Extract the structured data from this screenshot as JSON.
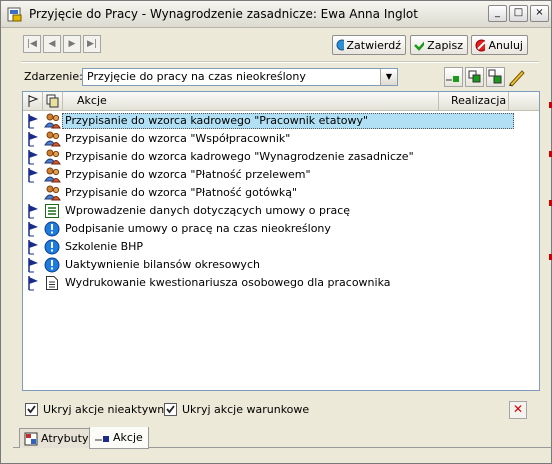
{
  "window": {
    "title": "Przyjęcie do Pracy - Wynagrodzenie zasadnicze:  Ewa Anna Inglot",
    "controls": {
      "minimize": "_",
      "maximize": "□",
      "close": "×"
    }
  },
  "nav": {
    "first": "|◀",
    "prev": "◀",
    "next": "▶",
    "last": "▶|"
  },
  "actions": {
    "confirm": "Zatwierdź",
    "save": "Zapisz",
    "cancel": "Anuluj"
  },
  "event": {
    "label": "Zdarzenie:",
    "value": "Przyjęcie do pracy na czas nieokreślony"
  },
  "list": {
    "headers": {
      "action": "Akcje",
      "realization": "Realizacja"
    },
    "rows": [
      {
        "text": "Przypisanie do wzorca kadrowego \"Pracownik etatowy\"",
        "icon": "people-icon",
        "flag": true,
        "selected": true
      },
      {
        "text": "Przypisanie do wzorca \"Współpracownik\"",
        "icon": "people-icon",
        "flag": true,
        "selected": false
      },
      {
        "text": "Przypisanie do wzorca kadrowego \"Wynagrodzenie zasadnicze\"",
        "icon": "people-icon",
        "flag": true,
        "selected": false
      },
      {
        "text": "Przypisanie do wzorca \"Płatność przelewem\"",
        "icon": "people-icon",
        "flag": true,
        "selected": false
      },
      {
        "text": "Przypisanie do wzorca \"Płatność gotówką\"",
        "icon": "people-icon",
        "flag": false,
        "selected": false
      },
      {
        "text": "Wprowadzenie danych dotyczących umowy o pracę",
        "icon": "form-icon",
        "flag": true,
        "selected": false
      },
      {
        "text": "Podpisanie umowy o pracę na czas nieokreślony",
        "icon": "info-icon",
        "flag": true,
        "selected": false
      },
      {
        "text": "Szkolenie BHP",
        "icon": "info-icon",
        "flag": true,
        "selected": false
      },
      {
        "text": "Uaktywnienie bilansów okresowych",
        "icon": "info-icon",
        "flag": true,
        "selected": false
      },
      {
        "text": "Wydrukowanie kwestionariusza osobowego dla pracownika",
        "icon": "document-icon",
        "flag": true,
        "selected": false
      }
    ]
  },
  "checkboxes": {
    "hide_inactive": {
      "label": "Ukryj akcje nieaktywne",
      "checked": true
    },
    "hide_conditional": {
      "label": "Ukryj akcje warunkowe",
      "checked": true
    }
  },
  "tabs": [
    {
      "label": "Atrybuty",
      "active": false
    },
    {
      "label": "Akcje",
      "active": true
    }
  ],
  "colors": {
    "selection": "#b1e0f5",
    "window_bg": "#ece9d8",
    "accent_red": "#d40000"
  }
}
